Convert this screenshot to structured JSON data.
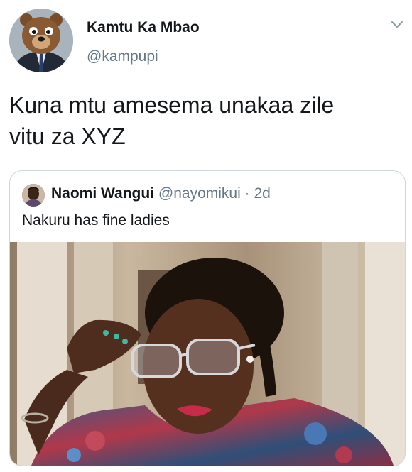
{
  "author": {
    "name": "Kamtu Ka Mbao",
    "handle": "@kampupi"
  },
  "tweet": {
    "text_line1": "Kuna mtu amesema unakaa zile",
    "text_line2": "vitu za XYZ"
  },
  "quoted": {
    "name": "Naomi Wangui",
    "handle": "@nayomikui",
    "separator": "·",
    "time": "2d",
    "text": "Nakuru has fine ladies"
  },
  "icons": {
    "menu": "chevron-down-icon"
  },
  "colors": {
    "primary_text": "#14171a",
    "secondary_text": "#657786",
    "border": "#ccd6dd"
  }
}
